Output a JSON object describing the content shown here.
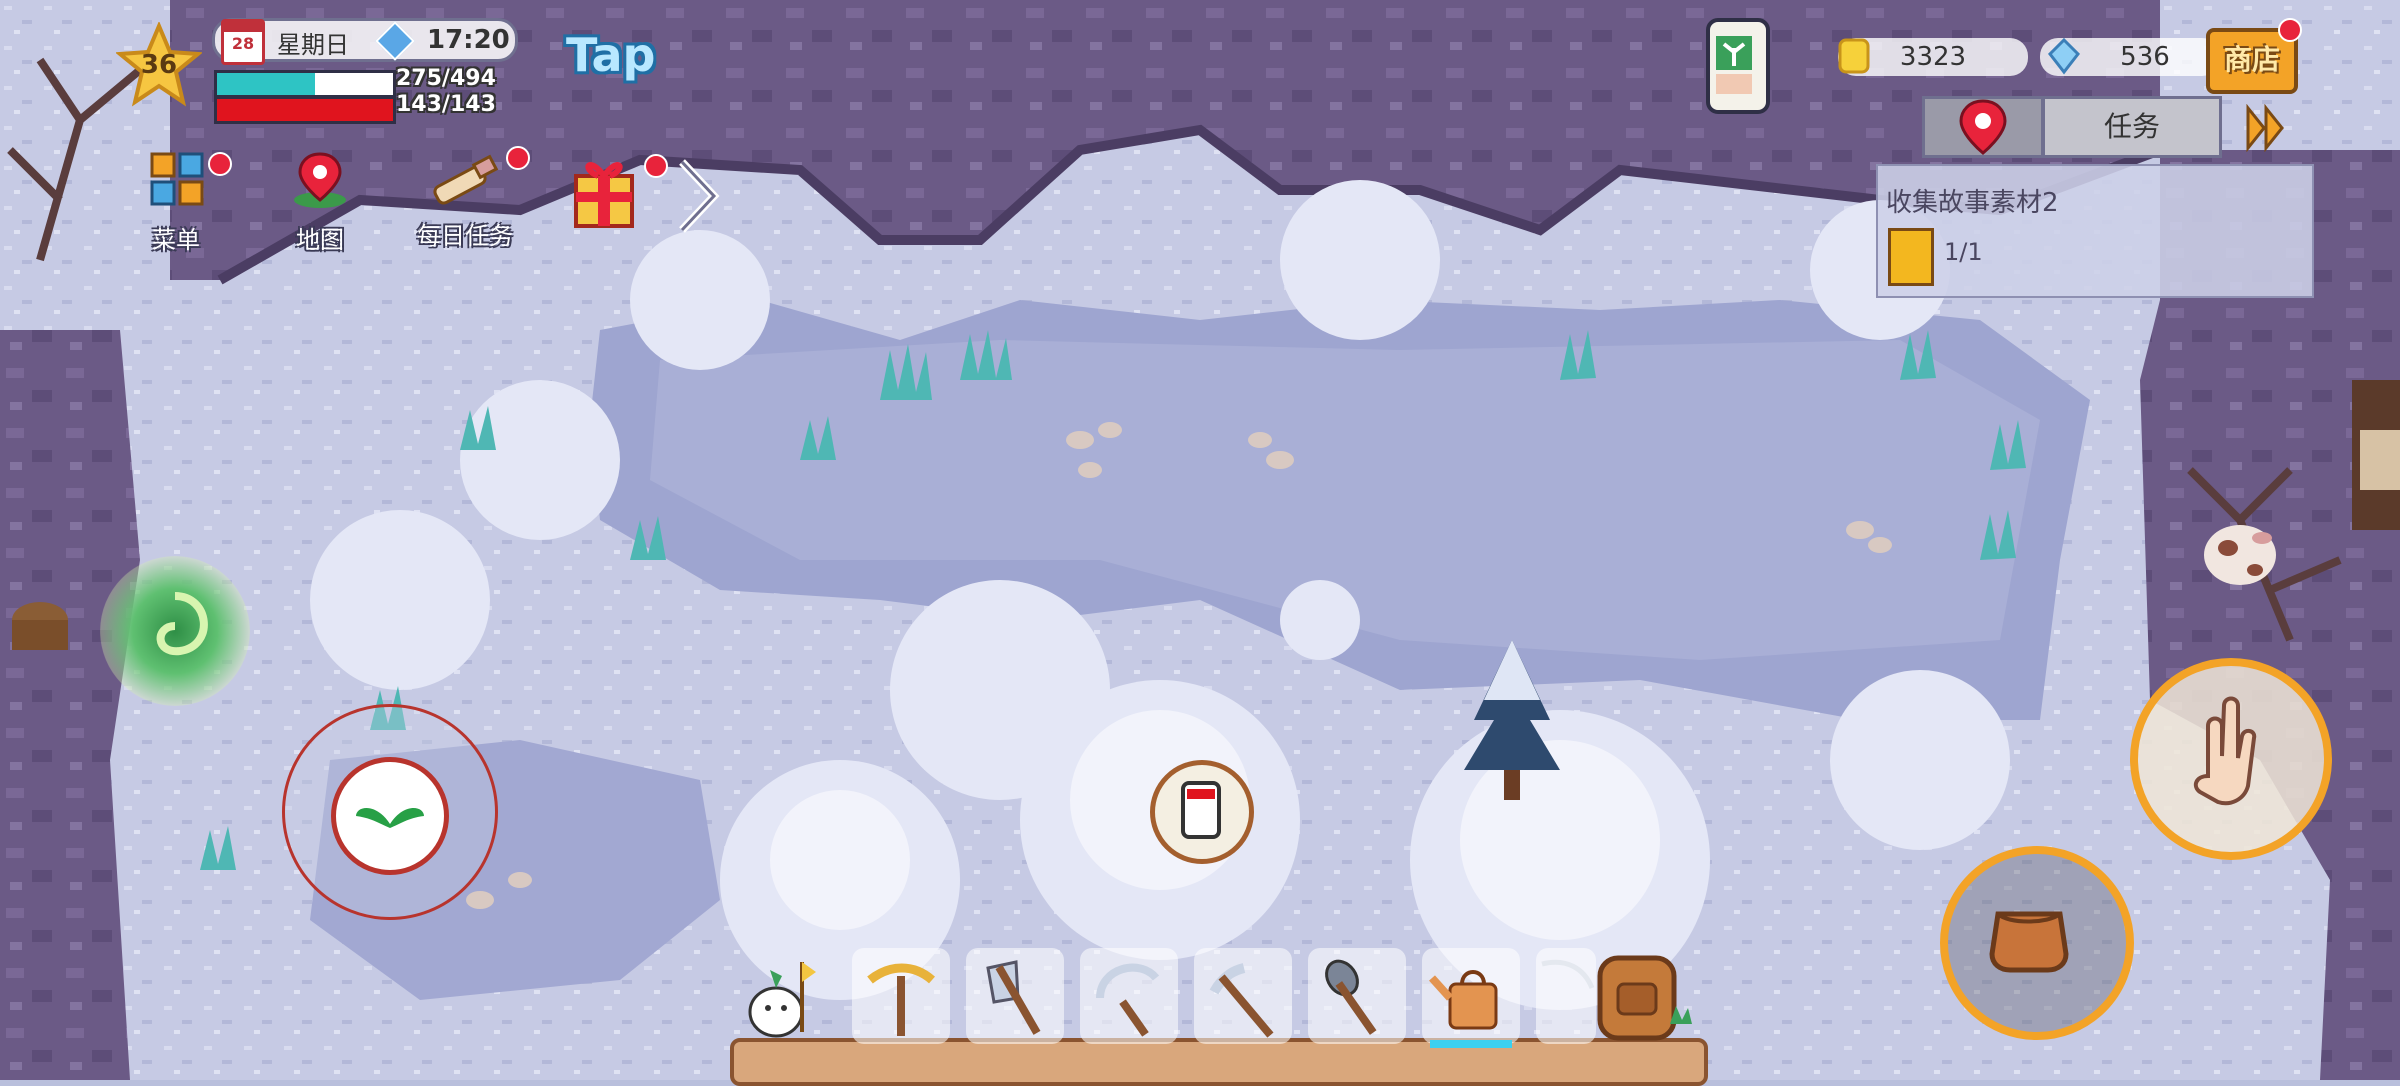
{
  "player": {
    "level": "36",
    "hp": "275/494",
    "stamina": "143/143",
    "hp_fraction": 0.557,
    "stamina_fraction": 1.0
  },
  "clock": {
    "weekday": "星期日",
    "time": "17:20",
    "calendar_badge": "28"
  },
  "tap_label": "Tap",
  "currency": {
    "gold": "3323",
    "gems": "536"
  },
  "shop_label": "商店",
  "task_button_label": "任务",
  "quest": {
    "title": "收集故事素材2",
    "progress": "1/1"
  },
  "shortcuts": [
    {
      "label": "菜单",
      "icon": "menu-grid-icon"
    },
    {
      "label": "地图",
      "icon": "map-pin-icon"
    },
    {
      "label": "每日任务",
      "icon": "telescope-icon"
    }
  ],
  "toolbar": [
    "pickaxe-icon",
    "axe-icon",
    "sickle-icon",
    "hoe-icon",
    "shovel-icon",
    "watering-can-icon",
    "fishing-rod-icon",
    "backpack-icon"
  ],
  "colors": {
    "hp_bar": "#2ec4c4",
    "stamina_bar": "#e0141e",
    "accent_orange": "#f3a327",
    "red_badge": "#e8233b"
  }
}
